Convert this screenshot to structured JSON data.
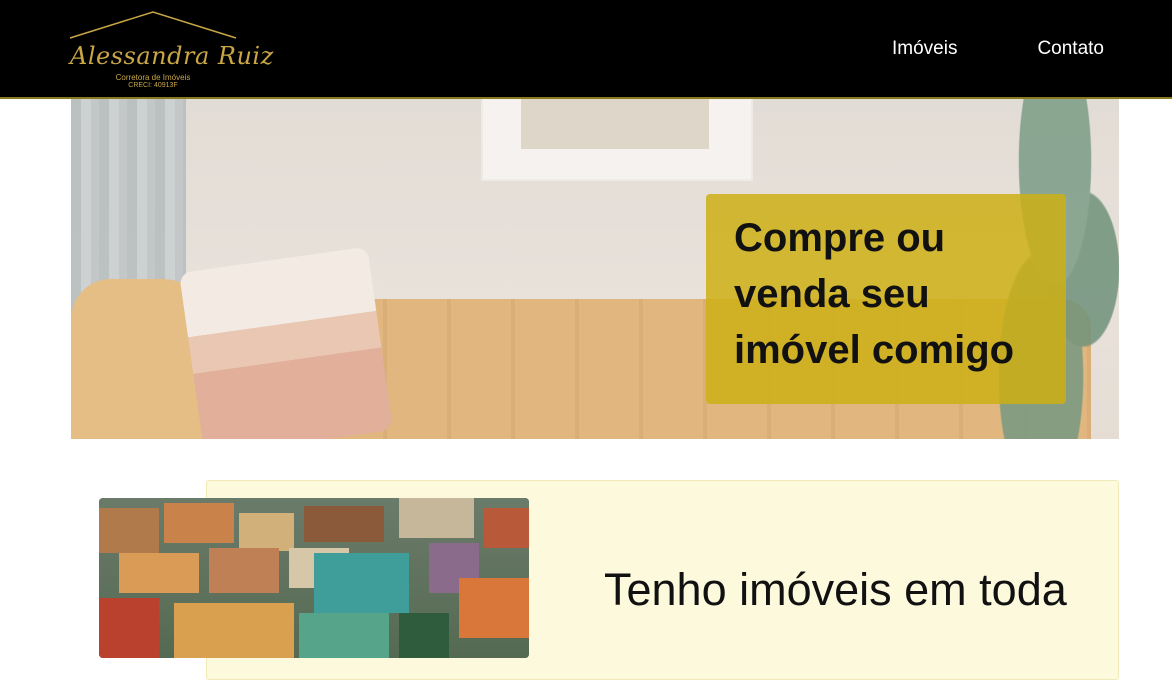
{
  "header": {
    "logo": {
      "name": "Alessandra Ruiz",
      "subtitle": "Corretora de Imóveis",
      "creci": "CRECI: 40913F"
    },
    "nav": [
      {
        "label": "Imóveis"
      },
      {
        "label": "Contato"
      }
    ]
  },
  "hero": {
    "headline_line1": "Compre ou",
    "headline_line2": "venda seu",
    "headline_line3": "imóvel comigo"
  },
  "intro": {
    "text": "Tenho imóveis em toda"
  },
  "colors": {
    "header_bg": "#000000",
    "brand_gold": "#c9a646",
    "hero_box": "#cdaf14",
    "section_bg": "#fdf9dd"
  }
}
